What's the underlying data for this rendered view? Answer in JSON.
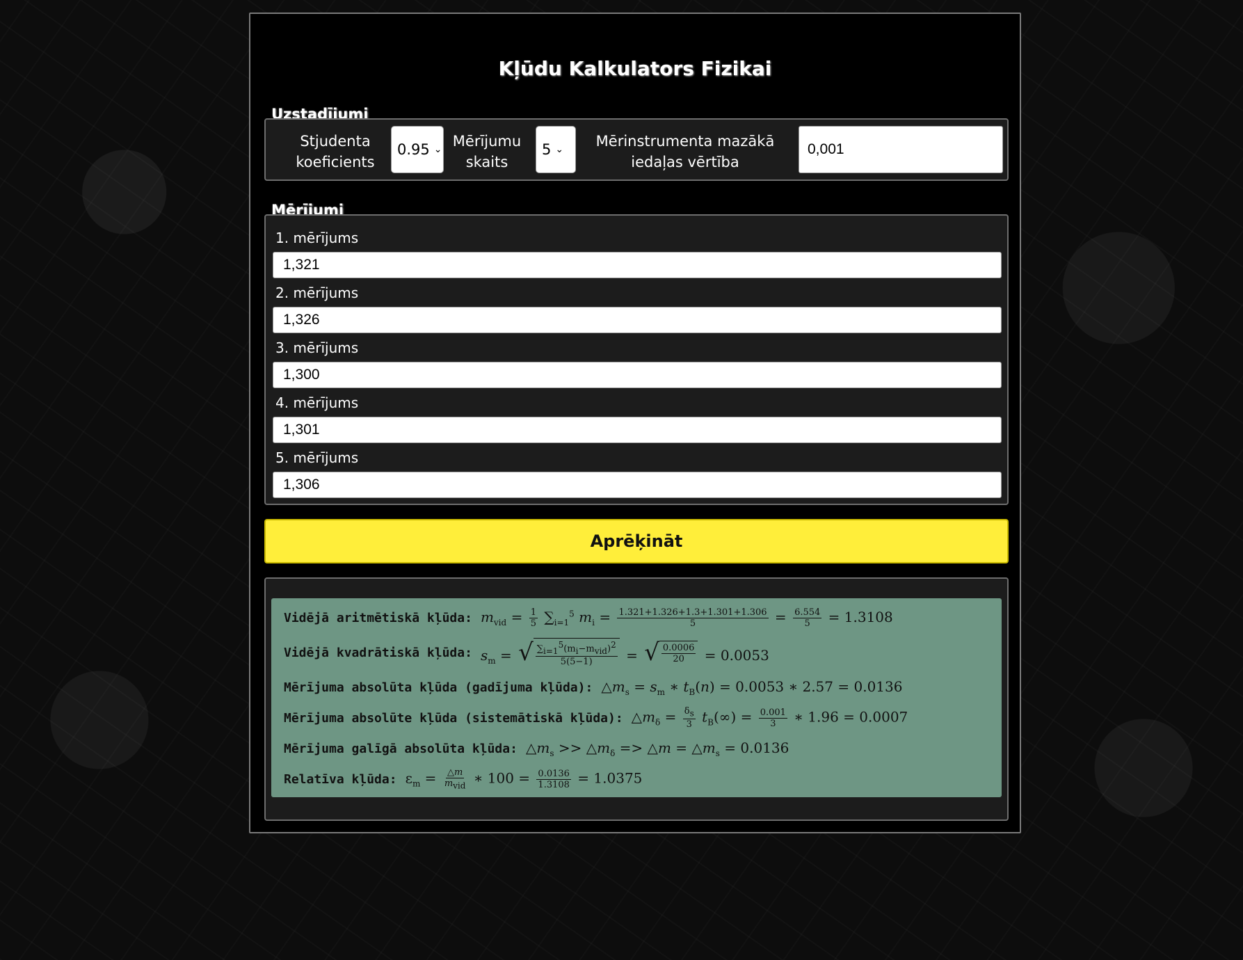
{
  "app": {
    "title": "Kļūdu Kalkulators Fizikai"
  },
  "settings": {
    "section_label": "Uzstadījumi",
    "student_label_1": "Stjudenta",
    "student_label_2": "koeficients",
    "student_value": "0.95",
    "count_label_1": "Mērījumu",
    "count_label_2": "skaits",
    "count_value": "5",
    "division_label_1": "Mērinstrumenta mazākā",
    "division_label_2": "iedaļas vērtība",
    "division_value": "0,001"
  },
  "measurements": {
    "section_label": "Mērījumi",
    "items": [
      {
        "label": "1. mērījums",
        "value": "1,321"
      },
      {
        "label": "2. mērījums",
        "value": "1,326"
      },
      {
        "label": "3. mērījums",
        "value": "1,300"
      },
      {
        "label": "4. mērījums",
        "value": "1,301"
      },
      {
        "label": "5. mērījums",
        "value": "1,306"
      }
    ]
  },
  "actions": {
    "calculate_label": "Aprēķināt"
  },
  "results": {
    "mean_label": "Vidējā aritmētiskā kļūda:",
    "mean_sum": "1.321+1.326+1.3+1.301+1.306",
    "mean_n": "5",
    "mean_total": "6.554",
    "mean_value": "1.3108",
    "sq_label": "Vidējā kvadrātiskā kļūda:",
    "sq_num_value": "0.0006",
    "sq_den_value": "20",
    "sq_value": "0.0053",
    "abs_random_label": "Mērījuma absolūta kļūda (gadījuma kļūda):",
    "t_n": "2.57",
    "abs_random_value": "0.0136",
    "abs_sys_label": "Mērījuma absolūte kļūda (sistemātiskā kļūda):",
    "sys_delta": "0.001",
    "t_inf": "1.96",
    "abs_sys_value": "0.0007",
    "final_label": "Mērījuma galīgā absolūta kļūda:",
    "final_value": "0.0136",
    "rel_label": "Relatīva kļūda:",
    "rel_num": "0.0136",
    "rel_den": "1.3108",
    "rel_value": "1.0375"
  }
}
